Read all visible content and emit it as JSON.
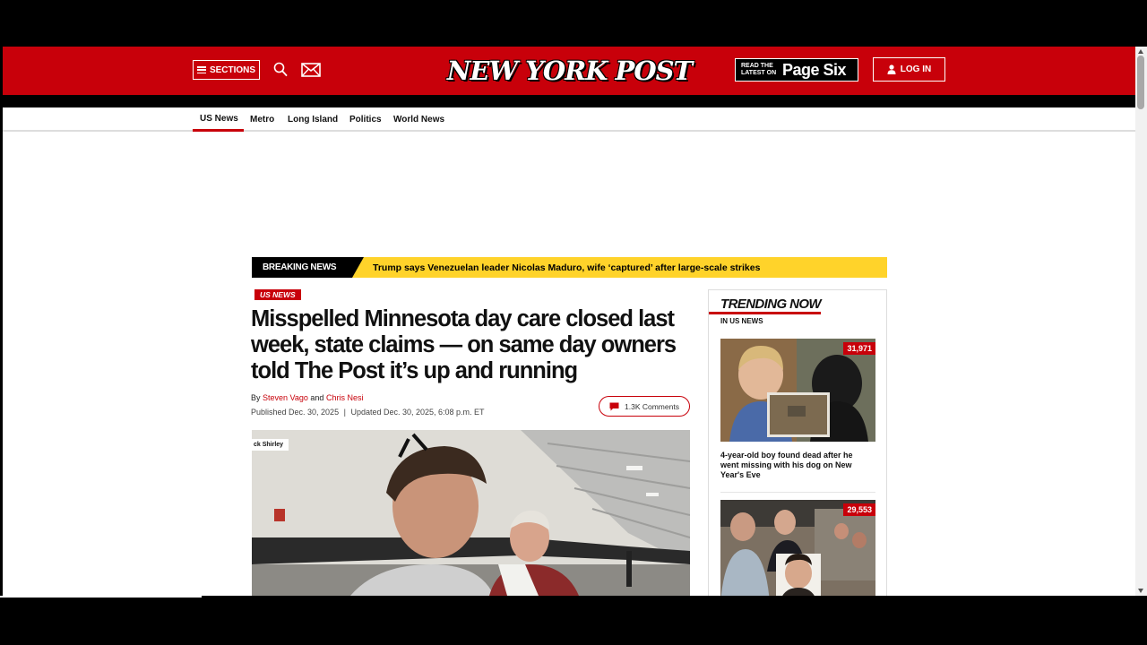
{
  "header": {
    "sections_label": "SECTIONS",
    "logo_text": "NEW YORK POST",
    "pagesix_small": "READ THE LATEST ON",
    "pagesix_big": "Page Six",
    "login_label": "LOG IN",
    "brand_color": "#c8000a"
  },
  "subnav": {
    "items": [
      {
        "label": "US News",
        "active": true
      },
      {
        "label": "Metro"
      },
      {
        "label": "Long Island"
      },
      {
        "label": "Politics"
      },
      {
        "label": "World News"
      }
    ]
  },
  "breaking": {
    "label": "BREAKING NEWS",
    "text": "Trump says Venezuelan leader Nicolas Maduro, wife ‘captured’ after large-scale strikes"
  },
  "article": {
    "section_tag": "US NEWS",
    "headline": "Misspelled Minnesota day care closed last week, state claims — on same day owners told The Post it’s up and running",
    "by_prefix": "By",
    "author1": "Steven Vago",
    "and": "and",
    "author2": "Chris Nesi",
    "published": "Published Dec. 30, 2025",
    "updated": "Updated Dec. 30, 2025, 6:08 p.m. ET",
    "comments": "1.3K Comments",
    "image_credit": "ck Shirley"
  },
  "trending": {
    "title": "TRENDING NOW",
    "subtitle": "IN US NEWS",
    "items": [
      {
        "count": "31,971",
        "caption": "4-year-old boy found dead after he went missing with his dog on New Year's Eve"
      },
      {
        "count": "29,553",
        "caption": ""
      }
    ]
  }
}
